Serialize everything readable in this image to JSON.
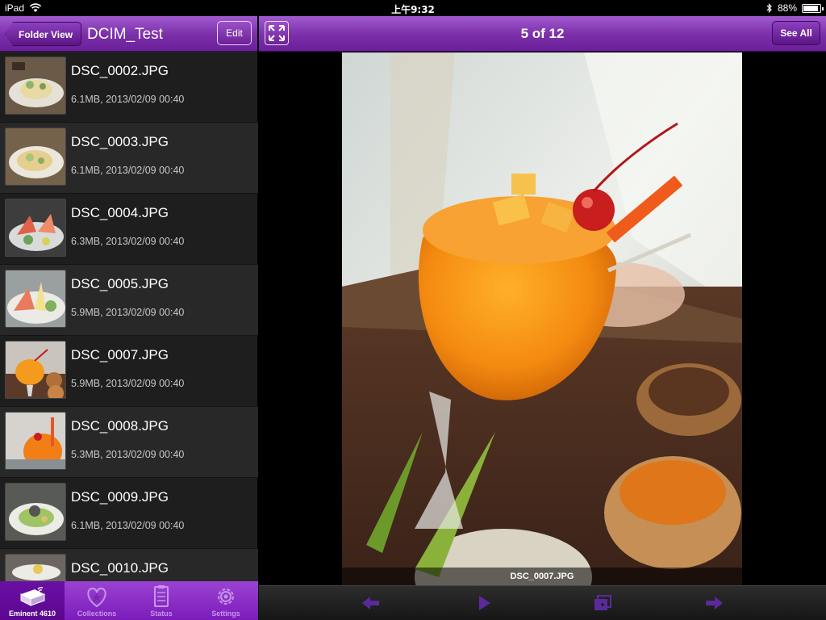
{
  "statusbar": {
    "device": "iPad",
    "time": "上午9:32",
    "battery": "88%",
    "battery_level": 0.88
  },
  "left_nav": {
    "back_label": "Folder View",
    "title": "DCIM_Test",
    "edit_label": "Edit"
  },
  "files": [
    {
      "name": "DSC_0002.JPG",
      "meta": "6.1MB, 2013/02/09 00:40"
    },
    {
      "name": "DSC_0003.JPG",
      "meta": "6.1MB, 2013/02/09 00:40"
    },
    {
      "name": "DSC_0004.JPG",
      "meta": "6.3MB, 2013/02/09 00:40"
    },
    {
      "name": "DSC_0005.JPG",
      "meta": "5.9MB, 2013/02/09 00:40"
    },
    {
      "name": "DSC_0007.JPG",
      "meta": "5.9MB, 2013/02/09 00:40"
    },
    {
      "name": "DSC_0008.JPG",
      "meta": "5.3MB, 2013/02/09 00:40"
    },
    {
      "name": "DSC_0009.JPG",
      "meta": "6.1MB, 2013/02/09 00:40"
    },
    {
      "name": "DSC_0010.JPG",
      "meta": ""
    }
  ],
  "tabs": [
    {
      "label": "Eminent 4610",
      "icon": "drive-icon"
    },
    {
      "label": "Collections",
      "icon": "heart-icon"
    },
    {
      "label": "Status",
      "icon": "clipboard-icon"
    },
    {
      "label": "Settings",
      "icon": "gear-icon"
    }
  ],
  "viewer": {
    "counter": "5 of 12",
    "see_all_label": "See All",
    "caption": "DSC_0007.JPG"
  },
  "colors": {
    "accent_purple": "#7a2ea8",
    "toolbar_icon_purple": "#5a2a9a"
  }
}
